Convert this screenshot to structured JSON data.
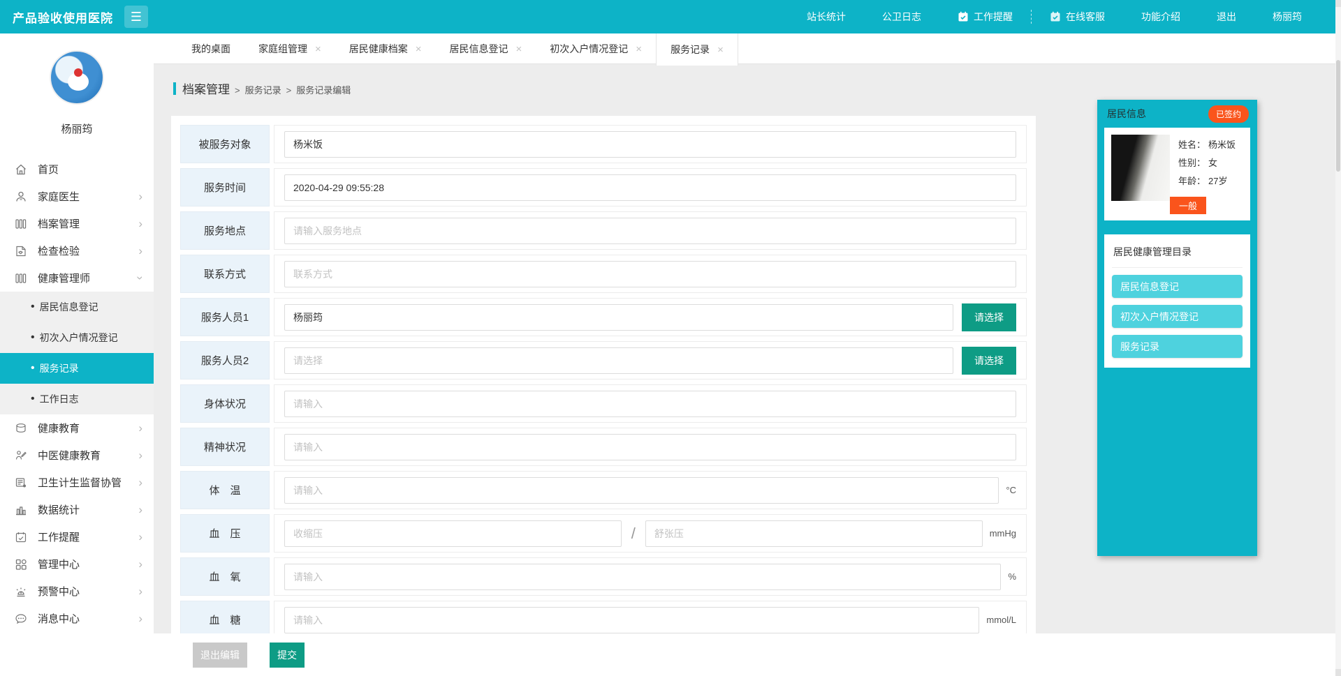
{
  "topbar": {
    "title": "产品验收使用医院",
    "nav": [
      {
        "label": "站长统计"
      },
      {
        "label": "公卫日志"
      },
      {
        "label": "工作提醒"
      },
      {
        "label": "在线客服"
      },
      {
        "label": "功能介绍"
      },
      {
        "label": "退出"
      },
      {
        "label": "杨丽筠"
      }
    ]
  },
  "sidebar": {
    "username": "杨丽筠",
    "items": [
      {
        "label": "首页"
      },
      {
        "label": "家庭医生"
      },
      {
        "label": "档案管理"
      },
      {
        "label": "检查检验"
      },
      {
        "label": "健康管理师"
      },
      {
        "label": "健康教育"
      },
      {
        "label": "中医健康教育"
      },
      {
        "label": "卫生计生监督协管"
      },
      {
        "label": "数据统计"
      },
      {
        "label": "工作提醒"
      },
      {
        "label": "管理中心"
      },
      {
        "label": "预警中心"
      },
      {
        "label": "消息中心"
      }
    ],
    "submenu": [
      {
        "label": "居民信息登记"
      },
      {
        "label": "初次入户情况登记"
      },
      {
        "label": "服务记录"
      },
      {
        "label": "工作日志"
      }
    ]
  },
  "tabs": [
    {
      "label": "我的桌面"
    },
    {
      "label": "家庭组管理",
      "close": "×"
    },
    {
      "label": "居民健康档案",
      "close": "×"
    },
    {
      "label": "居民信息登记",
      "close": "×"
    },
    {
      "label": "初次入户情况登记",
      "close": "×"
    },
    {
      "label": "服务记录",
      "close": "×"
    }
  ],
  "breadcrumb": {
    "root": "档案管理",
    "sep": ">",
    "items": [
      "服务记录",
      "服务记录编辑"
    ]
  },
  "form": {
    "rows": [
      {
        "label": "被服务对象",
        "value": "杨米饭"
      },
      {
        "label": "服务时间",
        "value": "2020-04-29 09:55:28"
      },
      {
        "label": "服务地点",
        "placeholder": "请输入服务地点"
      },
      {
        "label": "联系方式",
        "placeholder": "联系方式"
      },
      {
        "label": "服务人员1",
        "value": "杨丽筠",
        "button": "请选择"
      },
      {
        "label": "服务人员2",
        "placeholder": "请选择",
        "button": "请选择"
      },
      {
        "label": "身体状况",
        "placeholder": "请输入"
      },
      {
        "label": "精神状况",
        "placeholder": "请输入"
      },
      {
        "label": "体　温",
        "placeholder": "请输入",
        "unit": "°C"
      },
      {
        "label": "血　压",
        "ph1": "收缩压",
        "ph2": "舒张压",
        "slash": "/",
        "unit": "mmHg"
      },
      {
        "label": "血　氧",
        "placeholder": "请输入",
        "unit": "%"
      },
      {
        "label": "血　糖",
        "placeholder": "请输入",
        "unit": "mmol/L"
      }
    ]
  },
  "footer": {
    "exit": "退出编辑",
    "submit": "提交"
  },
  "resident_card": {
    "title": "居民信息",
    "signed_badge": "已签约",
    "fields": [
      {
        "k": "姓名：",
        "v": "杨米饭"
      },
      {
        "k": "性别：",
        "v": "女"
      },
      {
        "k": "年龄：",
        "v": "27岁"
      }
    ],
    "level_badge": "一般",
    "catalog_title": "居民健康管理目录",
    "catalog_buttons": [
      {
        "label": "居民信息登记"
      },
      {
        "label": "初次入户情况登记"
      },
      {
        "label": "服务记录"
      }
    ]
  },
  "colors": {
    "primary_teal": "#0db3c7",
    "button_green": "#0e9c85",
    "badge_orange": "#fa541c",
    "catalog_teal": "#4ed2de",
    "label_bg": "#eaf3fa"
  }
}
